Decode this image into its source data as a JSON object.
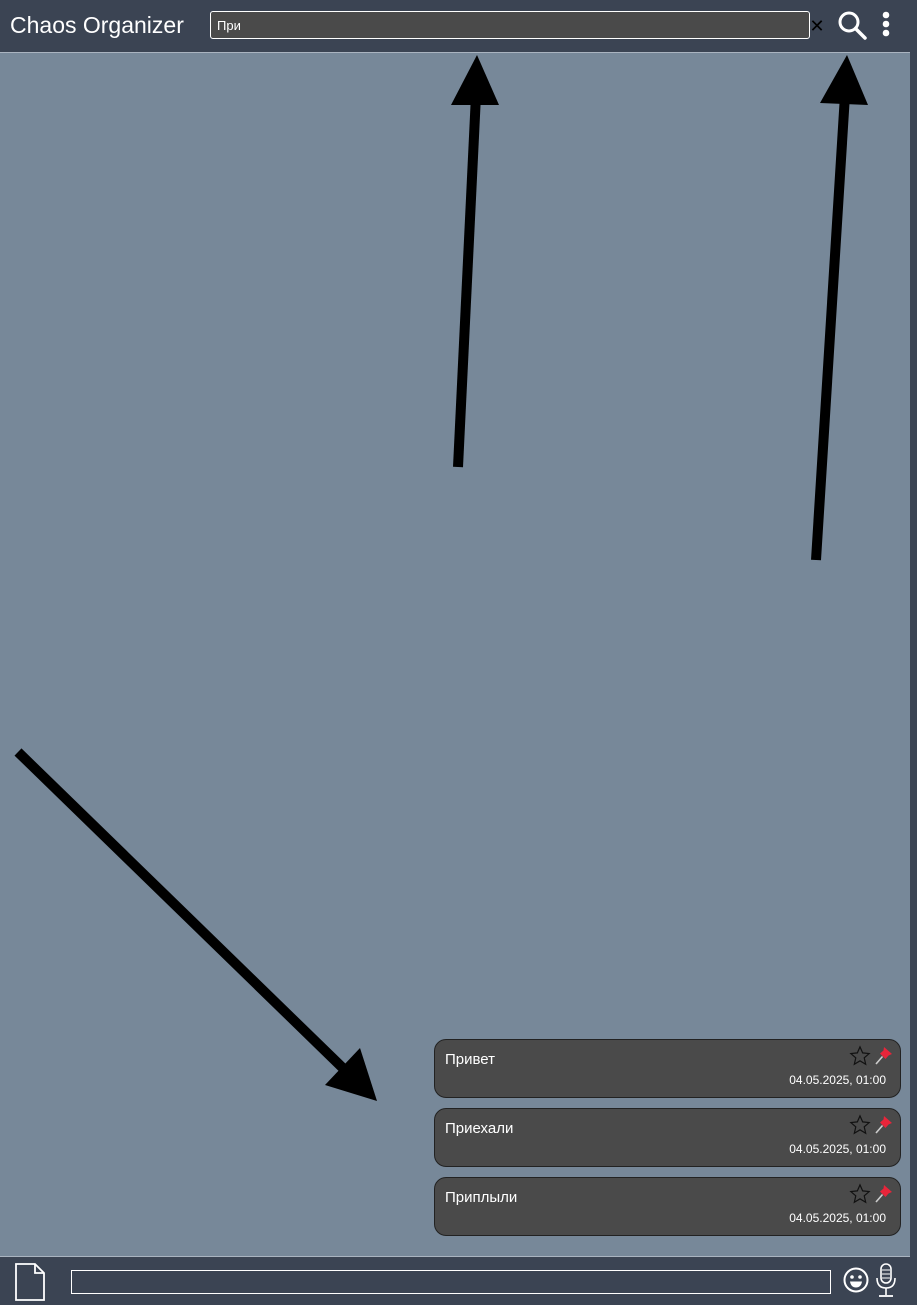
{
  "header": {
    "title": "Chaos Organizer",
    "search_value": "При",
    "clear_icon": "close-icon",
    "search_icon": "search-icon",
    "menu_icon": "kebab-menu-icon"
  },
  "messages": [
    {
      "text": "Привет",
      "time": "04.05.2025, 01:00"
    },
    {
      "text": "Приехали",
      "time": "04.05.2025, 01:00"
    },
    {
      "text": "Приплыли",
      "time": "04.05.2025, 01:00"
    }
  ],
  "footer": {
    "file_icon": "file-icon",
    "input_value": "",
    "emoji_icon": "emoji-icon",
    "mic_icon": "microphone-icon"
  },
  "colors": {
    "background": "#778899",
    "bar": "#3b4453",
    "card": "#4a4a4a",
    "pin": "#e8253a"
  }
}
